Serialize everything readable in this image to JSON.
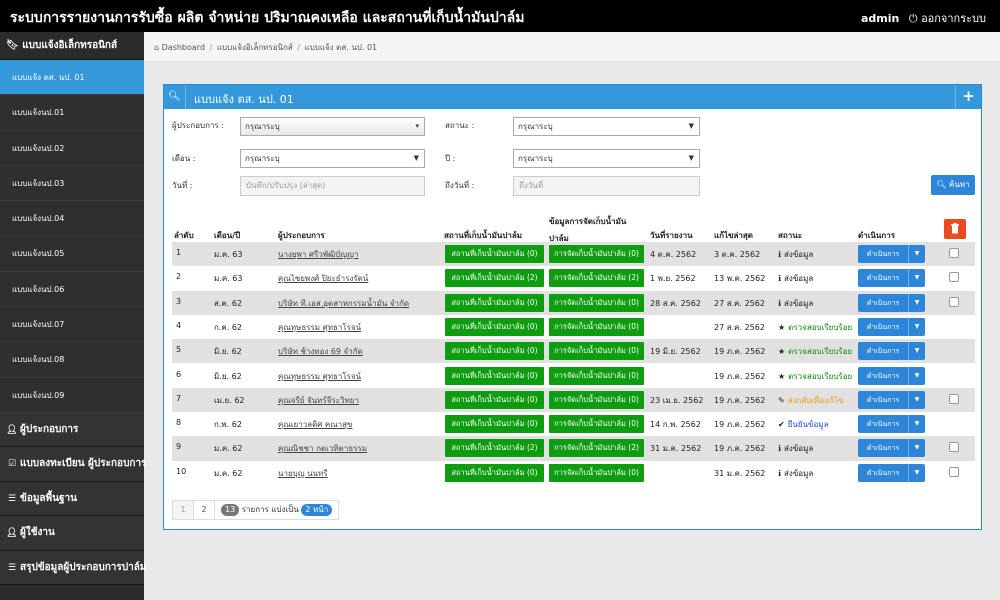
{
  "header": {
    "title": "ระบบการรายงานการรับซื้อ ผลิต จำหน่าย ปริมาณคงเหลือ และสถานที่เก็บน้ำมันปาล์ม",
    "user": "admin",
    "logout": "ออกจากระบบ"
  },
  "sidebar": {
    "section_label": "แบบแจ้งอิเล็กทรอนิกส์",
    "sub_items": [
      "แบบแจ้ง ตส. นป. 01",
      "แบบแจ้งนป.01",
      "แบบแจ้งนป.02",
      "แบบแจ้งนป.03",
      "แบบแจ้งนป.04",
      "แบบแจ้งนป.05",
      "แบบแจ้งนป.06",
      "แบบแจ้งนป.07",
      "แบบแจ้งนป.08",
      "แบบแจ้งนป.09"
    ],
    "sections": [
      "ผู้ประกอบการ",
      "แบบลงทะเบียน ผู้ประกอบการ",
      "ข้อมูลพื้นฐาน",
      "ผู้ใช้งาน",
      "สรุปข้อมูลผู้ประกอบการปาล์ม"
    ]
  },
  "breadcrumb": {
    "home": "Dashboard",
    "level1": "แบบแจ้งอิเล็กทรอนิกส์",
    "level2": "แบบแจ้ง ตส. นป. 01"
  },
  "panel": {
    "title": "แบบแจ้ง ตส. นป. 01",
    "plus": "+"
  },
  "filters": {
    "operator_label": "ผู้ประกอบการ :",
    "operator_value": "กรุณาระบุ",
    "status_label": "สถานะ :",
    "status_value": "กรุณาระบุ",
    "month_label": "เดือน :",
    "month_value": "กรุณาระบุ",
    "year_label": "ปี :",
    "year_value": "กรุณาระบุ",
    "date_label": "วันที่ :",
    "date_placeholder": "บันทึก/ปรับปรุง (ล่าสุด)",
    "todate_label": "ถึงวันที่ :",
    "todate_placeholder": "ถึงวันที่",
    "search_button": "ค้นหา"
  },
  "table": {
    "headers": {
      "no": "ลำดับ",
      "month": "เดือน/ปี",
      "operator": "ผู้ประกอบการ",
      "storage": "สถานที่เก็บน้ำมันปาล์ม",
      "mgmt": "ข้อมูลการจัดเก็บน้ำมัน ปาล์ม",
      "reported": "วันที่รายงาน",
      "updated": "แก้ไขล่าสุด",
      "status": "สถานะ",
      "action": "ดำเนินการ"
    },
    "storage_prefix": "สถานที่เก็บน้ำมันปาล์ม",
    "mgmt_prefix": "การจัดเก็บน้ำมันปาล์ม",
    "action_label": "ดำเนินการ",
    "rows": [
      {
        "no": "1",
        "month": "ม.ค. 63",
        "operator": "นางยุพา ศรีวพัฒิบัญญา",
        "storage_count": "(0)",
        "mgmt_count": "(0)",
        "reported": "4 ต.ค. 2562",
        "updated": "3 ต.ค. 2562",
        "status": "ส่งข้อมูล",
        "status_icon": "info-icon",
        "status_color": "#222222",
        "checkbox": true
      },
      {
        "no": "2",
        "month": "ม.ค. 63",
        "operator": "คุณไชยพงศ์ ปิยะธำรงรัตน์",
        "storage_count": "(2)",
        "mgmt_count": "(2)",
        "reported": "1 พ.ย. 2562",
        "updated": "13 พ.ค. 2562",
        "status": "ส่งข้อมูล",
        "status_icon": "info-icon",
        "status_color": "#222222",
        "checkbox": true
      },
      {
        "no": "3",
        "month": "ส.ค. 62",
        "operator": "บริษัท ที.เอส.อุตสาหกรรมน้ำมัน จำกัด",
        "storage_count": "(0)",
        "mgmt_count": "(0)",
        "reported": "28 ส.ค. 2562",
        "updated": "27 ส.ค. 2562",
        "status": "ส่งข้อมูล",
        "status_icon": "info-icon",
        "status_color": "#222222",
        "checkbox": true
      },
      {
        "no": "4",
        "month": "ก.ค. 62",
        "operator": "คุณทุษธรรม ศุทธาโรจน์",
        "storage_count": "(0)",
        "mgmt_count": "(0)",
        "reported": "",
        "updated": "27 ส.ค. 2562",
        "status": "ตรวจสอบเรียบร้อย",
        "status_icon": "star-icon",
        "status_color": "#118811",
        "checkbox": false
      },
      {
        "no": "5",
        "month": "มิ.ย. 62",
        "operator": "บริษัท ช้างทอง 69 จำกัด",
        "storage_count": "(0)",
        "mgmt_count": "(0)",
        "reported": "19 มิ.ย. 2562",
        "updated": "19 ภ.ค. 2562",
        "status": "ตรวจสอบเรียบร้อย",
        "status_icon": "star-icon",
        "status_color": "#118811",
        "checkbox": false
      },
      {
        "no": "6",
        "month": "มิ.ย. 62",
        "operator": "คุณทุษธรรม ศุทธาโรจน์",
        "storage_count": "(0)",
        "mgmt_count": "(0)",
        "reported": "",
        "updated": "19 ภ.ค. 2562",
        "status": "ตรวจสอบเรียบร้อย",
        "status_icon": "star-icon",
        "status_color": "#118811",
        "checkbox": false
      },
      {
        "no": "7",
        "month": "เม.ย. 62",
        "operator": "คุณจรีย์ จันทร์จีระวิทยา",
        "storage_count": "(0)",
        "mgmt_count": "(0)",
        "reported": "23 เม.ย. 2562",
        "updated": "19 ภ.ค. 2562",
        "status": "ส่งกลับเพื่อแก้ไข",
        "status_icon": "pencil-icon",
        "status_color": "#e8a317",
        "checkbox": true
      },
      {
        "no": "8",
        "month": "ก.พ. 62",
        "operator": "คุณเยาวลดิศ คณาสุข",
        "storage_count": "(0)",
        "mgmt_count": "(0)",
        "reported": "14 ก.พ. 2562",
        "updated": "19 ภ.ค. 2562",
        "status": "ยืนยันข้อมูล",
        "status_icon": "check-icon",
        "status_color": "#1f4fd6",
        "checkbox": false
      },
      {
        "no": "9",
        "month": "ม.ค. 62",
        "operator": "คุณณิชชา กตเวทิตาธรรม",
        "storage_count": "(2)",
        "mgmt_count": "(2)",
        "reported": "31 ม.ค. 2562",
        "updated": "19 ภ.ค. 2562",
        "status": "ส่งข้อมูล",
        "status_icon": "info-icon",
        "status_color": "#222222",
        "checkbox": true
      },
      {
        "no": "10",
        "month": "ม.ค. 62",
        "operator": "นายบุญ นนทรี",
        "storage_count": "(0)",
        "mgmt_count": "(0)",
        "reported": "",
        "updated": "31 ม.ค. 2562",
        "status": "ส่งข้อมูล",
        "status_icon": "info-icon",
        "status_color": "#222222",
        "checkbox": true
      }
    ]
  },
  "pagination": {
    "page1": "1",
    "page2": "2",
    "total": "13",
    "total_text": "รายการ แบ่งเป็น",
    "pages": "2 หน้า"
  },
  "colors": {
    "topbar": "#000000",
    "accent": "#3498db",
    "green": "#0e9c11",
    "delete": "#ea4c1d"
  }
}
